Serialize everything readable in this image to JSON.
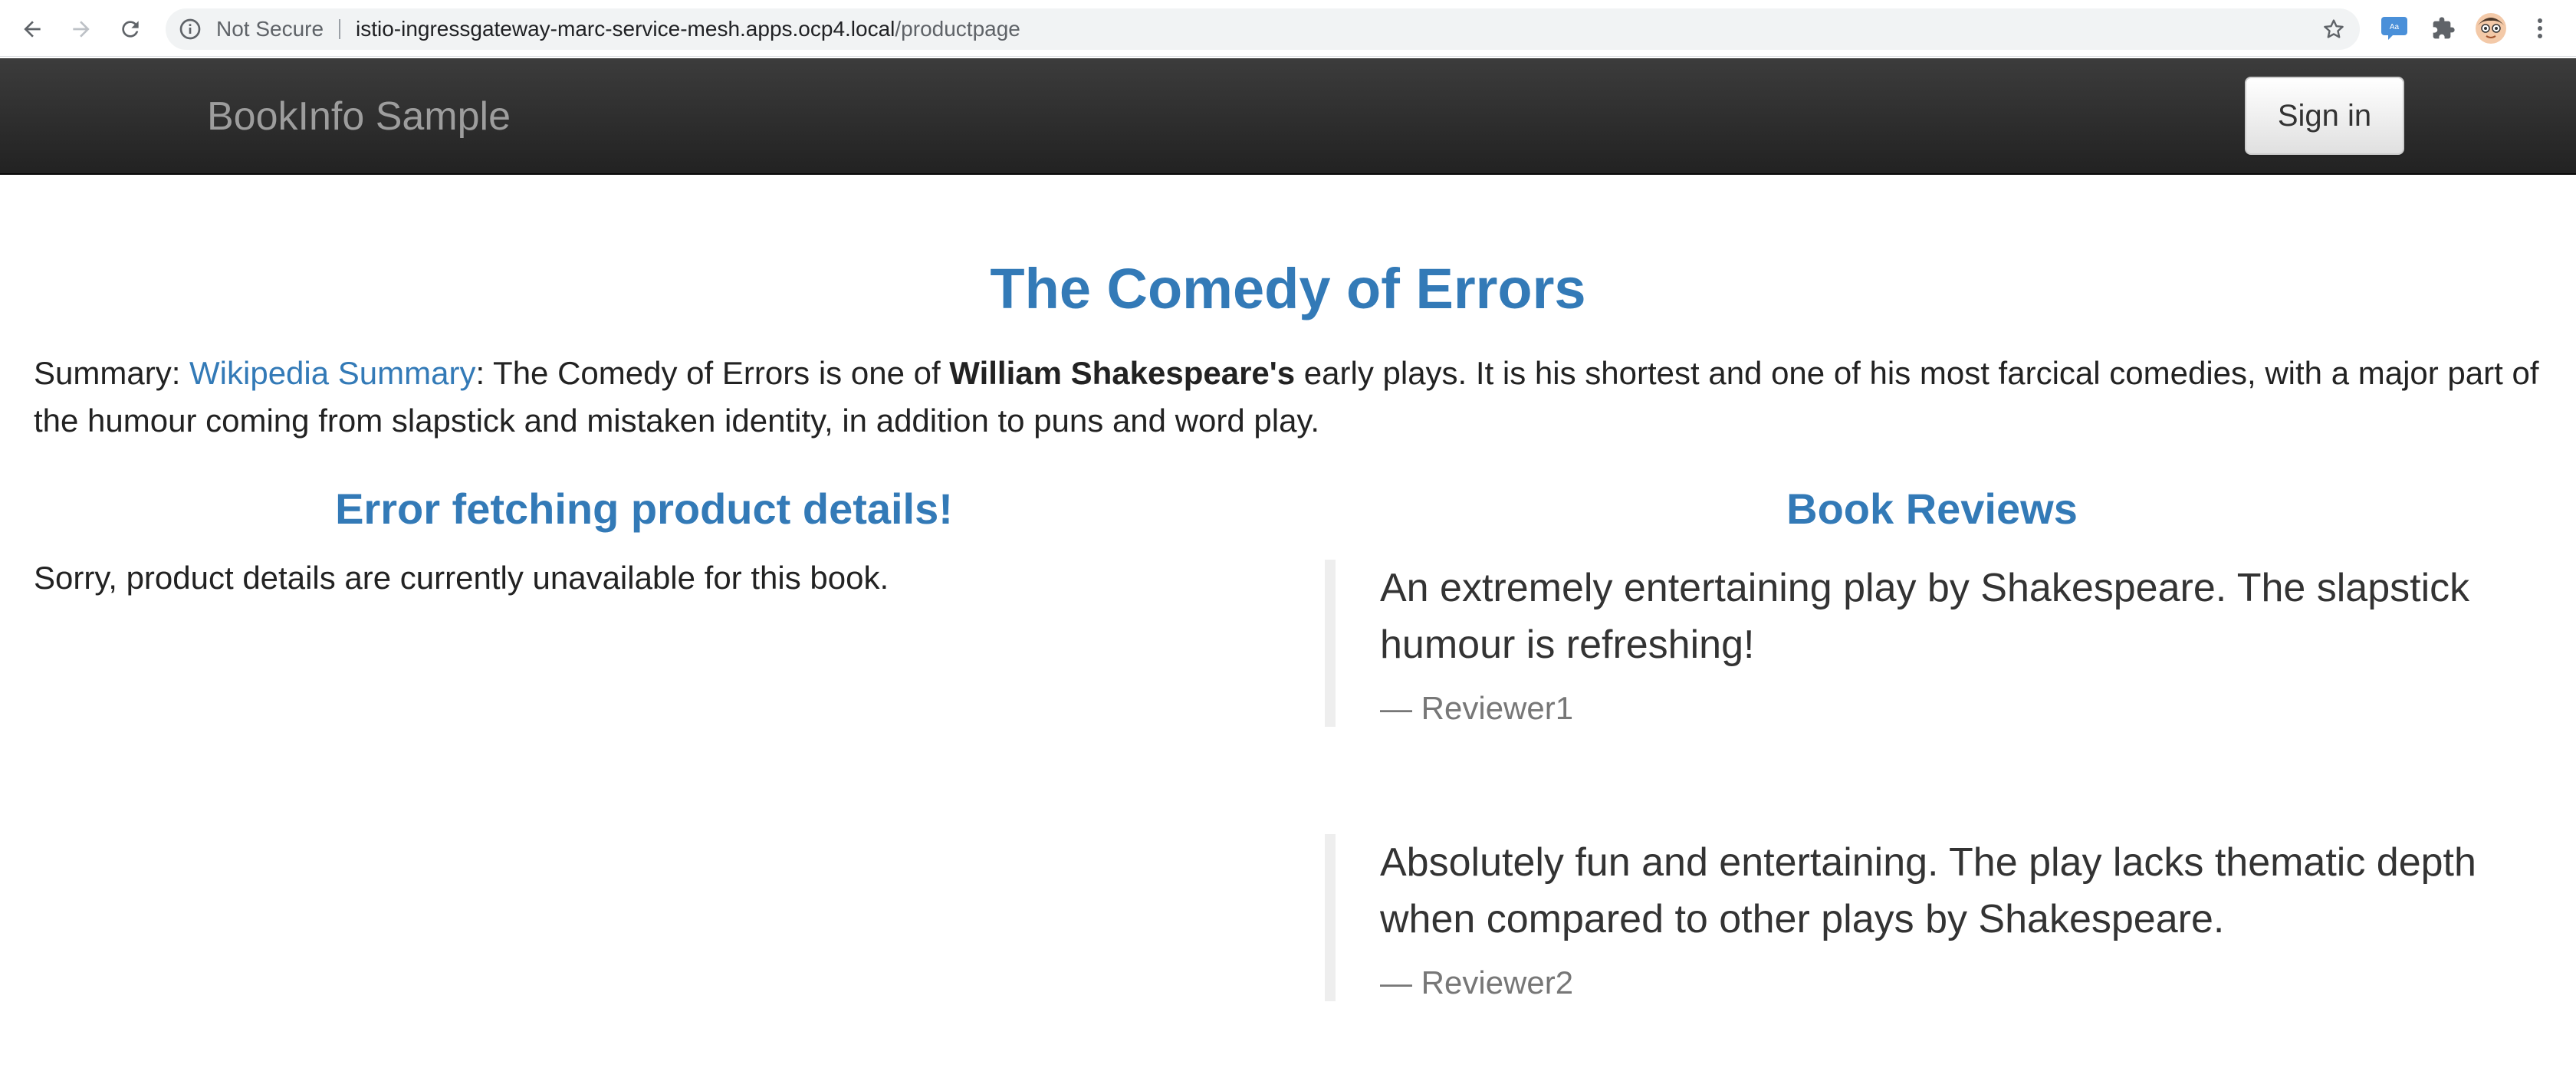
{
  "browser": {
    "security_label": "Not Secure",
    "url_host": "istio-ingressgateway-marc-service-mesh.apps.ocp4.local",
    "url_path": "/productpage",
    "icons": [
      "back-arrow-icon",
      "forward-arrow-icon",
      "reload-icon",
      "info-icon",
      "star-icon",
      "translate-extension-icon",
      "puzzle-extensions-icon",
      "profile-avatar-icon",
      "more-menu-icon"
    ]
  },
  "navbar": {
    "brand": "BookInfo Sample",
    "signin_label": "Sign in"
  },
  "product": {
    "title": "The Comedy of Errors",
    "summary_label": "Summary: ",
    "summary_link": "Wikipedia Summary",
    "summary_text_1": ": The Comedy of Errors is one of ",
    "summary_bold": "William Shakespeare's",
    "summary_text_2": " early plays. It is his shortest and one of his most farcical comedies, with a major part of the humour coming from slapstick and mistaken identity, in addition to puns and word play."
  },
  "details": {
    "heading": "Error fetching product details!",
    "message": "Sorry, product details are currently unavailable for this book."
  },
  "reviews": {
    "heading": "Book Reviews",
    "items": [
      {
        "text": "An extremely entertaining play by Shakespeare. The slapstick humour is refreshing!",
        "author": "— Reviewer1"
      },
      {
        "text": "Absolutely fun and entertaining. The play lacks thematic depth when compared to other plays by Shakespeare.",
        "author": "— Reviewer2"
      }
    ]
  },
  "colors": {
    "accent": "#337ab7",
    "navbar_bg": "#222222"
  }
}
